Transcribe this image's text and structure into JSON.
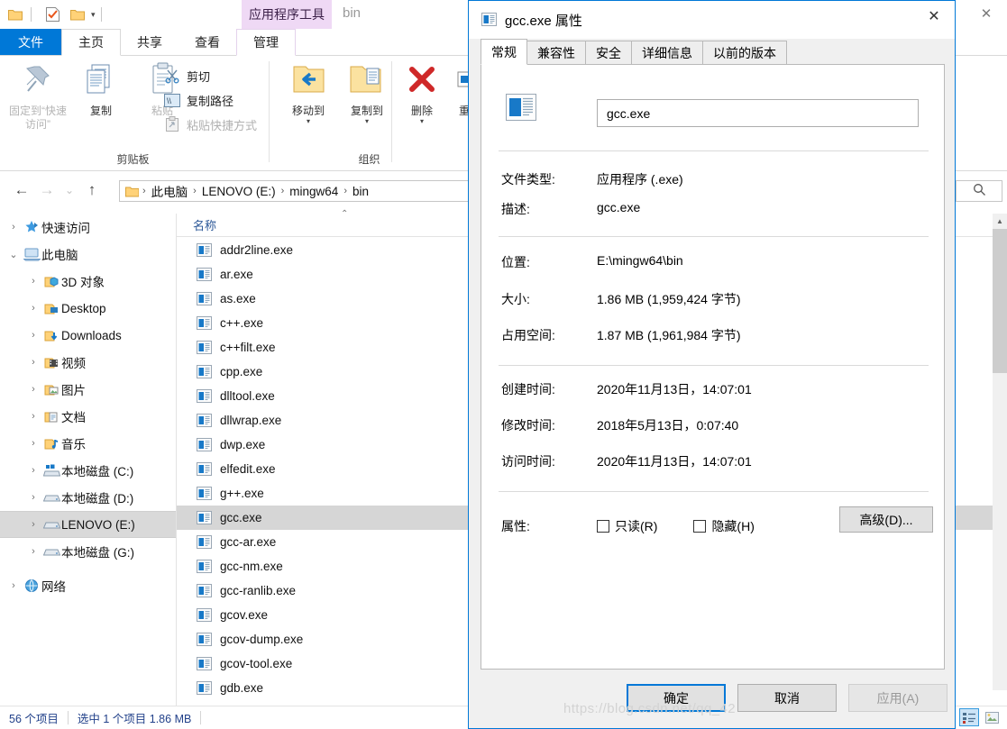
{
  "explorer": {
    "quick_access_toolbar": {
      "icons": [
        "folder-icon",
        "properties-check-icon",
        "new-folder-icon"
      ],
      "customize_caret": "▾"
    },
    "contextual_tab_group": "应用程序工具",
    "window_title": "bin",
    "window_buttons": {
      "close": "✕",
      "collapse_ribbon": "⌃",
      "help": "?"
    },
    "ribbon_tabs": [
      {
        "label": "文件",
        "state": "file"
      },
      {
        "label": "主页",
        "state": "active"
      },
      {
        "label": "共享",
        "state": "normal"
      },
      {
        "label": "查看",
        "state": "normal"
      },
      {
        "label": "管理",
        "state": "manage"
      }
    ],
    "ribbon": {
      "groups": [
        {
          "label": "剪贴板"
        },
        {
          "label": "组织"
        }
      ],
      "clipboard": {
        "pin_label": "固定到“快速访问”",
        "copy_label": "复制",
        "paste_label": "粘贴",
        "cut_label": "剪切",
        "copy_path_label": "复制路径",
        "paste_shortcut_label": "粘贴快捷方式"
      },
      "organize": {
        "move_to_label": "移动到",
        "copy_to_label": "复制到",
        "delete_label": "删除",
        "rename_label": "重命名"
      }
    },
    "address_bar": {
      "back": "←",
      "forward": "→",
      "recent": "⌄",
      "up": "↑",
      "breadcrumbs": [
        "此电脑",
        "LENOVO (E:)",
        "mingw64",
        "bin"
      ],
      "separator": "›",
      "search_placeholder": ""
    },
    "column_header": {
      "name": "名称",
      "sort_caret": "⌃"
    },
    "nav_pane": [
      {
        "label": "快速访问",
        "icon": "star-pin-icon",
        "expander": "›",
        "level": 1,
        "selected": false
      },
      {
        "label": "此电脑",
        "icon": "this-pc-icon",
        "expander": "⌄",
        "level": 1,
        "selected": false
      },
      {
        "label": "3D 对象",
        "icon": "3d-objects-icon",
        "expander": "›",
        "level": 2,
        "selected": false
      },
      {
        "label": "Desktop",
        "icon": "desktop-icon",
        "expander": "›",
        "level": 2,
        "selected": false
      },
      {
        "label": "Downloads",
        "icon": "downloads-icon",
        "expander": "›",
        "level": 2,
        "selected": false
      },
      {
        "label": "视频",
        "icon": "videos-icon",
        "expander": "›",
        "level": 2,
        "selected": false
      },
      {
        "label": "图片",
        "icon": "pictures-icon",
        "expander": "›",
        "level": 2,
        "selected": false
      },
      {
        "label": "文档",
        "icon": "documents-icon",
        "expander": "›",
        "level": 2,
        "selected": false
      },
      {
        "label": "音乐",
        "icon": "music-icon",
        "expander": "›",
        "level": 2,
        "selected": false
      },
      {
        "label": "本地磁盘 (C:)",
        "icon": "windows-drive-icon",
        "expander": "›",
        "level": 2,
        "selected": false
      },
      {
        "label": "本地磁盘 (D:)",
        "icon": "drive-icon",
        "expander": "›",
        "level": 2,
        "selected": false
      },
      {
        "label": "LENOVO (E:)",
        "icon": "drive-icon",
        "expander": "›",
        "level": 2,
        "selected": true
      },
      {
        "label": "本地磁盘 (G:)",
        "icon": "drive-icon",
        "expander": "›",
        "level": 2,
        "selected": false
      },
      {
        "label": "网络",
        "icon": "network-icon",
        "expander": "›",
        "level": 1,
        "selected": false
      }
    ],
    "files": [
      {
        "name": "addr2line.exe",
        "selected": false
      },
      {
        "name": "ar.exe",
        "selected": false
      },
      {
        "name": "as.exe",
        "selected": false
      },
      {
        "name": "c++.exe",
        "selected": false
      },
      {
        "name": "c++filt.exe",
        "selected": false
      },
      {
        "name": "cpp.exe",
        "selected": false
      },
      {
        "name": "dlltool.exe",
        "selected": false
      },
      {
        "name": "dllwrap.exe",
        "selected": false
      },
      {
        "name": "dwp.exe",
        "selected": false
      },
      {
        "name": "elfedit.exe",
        "selected": false
      },
      {
        "name": "g++.exe",
        "selected": false
      },
      {
        "name": "gcc.exe",
        "selected": true
      },
      {
        "name": "gcc-ar.exe",
        "selected": false
      },
      {
        "name": "gcc-nm.exe",
        "selected": false
      },
      {
        "name": "gcc-ranlib.exe",
        "selected": false
      },
      {
        "name": "gcov.exe",
        "selected": false
      },
      {
        "name": "gcov-dump.exe",
        "selected": false
      },
      {
        "name": "gcov-tool.exe",
        "selected": false
      },
      {
        "name": "gdb.exe",
        "selected": false
      }
    ],
    "status_bar": {
      "item_count": "56 个项目",
      "selection": "选中 1 个项目  1.86 MB"
    },
    "view_buttons": {
      "details": "details-view-icon",
      "large_icons": "large-icons-view-icon"
    }
  },
  "dialog": {
    "title": "gcc.exe 属性",
    "close_label": "✕",
    "tabs": [
      {
        "label": "常规",
        "active": true
      },
      {
        "label": "兼容性",
        "active": false
      },
      {
        "label": "安全",
        "active": false
      },
      {
        "label": "详细信息",
        "active": false
      },
      {
        "label": "以前的版本",
        "active": false
      }
    ],
    "file_name": "gcc.exe",
    "fields": [
      {
        "label": "文件类型:",
        "value": "应用程序 (.exe)",
        "highlighted": false
      },
      {
        "label": "描述:",
        "value": "gcc.exe",
        "highlighted": false
      },
      {
        "label": "位置:",
        "value": "E:\\mingw64\\bin",
        "highlighted": true
      },
      {
        "label": "大小:",
        "value": "1.86 MB (1,959,424 字节)",
        "highlighted": false
      },
      {
        "label": "占用空间:",
        "value": "1.87 MB (1,961,984 字节)",
        "highlighted": false
      },
      {
        "label": "创建时间:",
        "value": "2020年11月13日，14:07:01",
        "highlighted": false
      },
      {
        "label": "修改时间:",
        "value": "2018年5月13日，0:07:40",
        "highlighted": false
      },
      {
        "label": "访问时间:",
        "value": "2020年11月13日，14:07:01",
        "highlighted": false
      }
    ],
    "attributes": {
      "label": "属性:",
      "readonly_label": "只读(R)",
      "readonly_checked": false,
      "hidden_label": "隐藏(H)",
      "hidden_checked": false,
      "advanced_label": "高级(D)..."
    },
    "buttons": {
      "ok": "确定",
      "cancel": "取消",
      "apply": "应用(A)"
    }
  },
  "watermark": "https://blog.csdn.net/qq_42",
  "colors": {
    "accent": "#0078d7",
    "selection": "#0078d7",
    "contextual_tab": "#efd9f5",
    "row_selected": "#d6d6d6"
  }
}
